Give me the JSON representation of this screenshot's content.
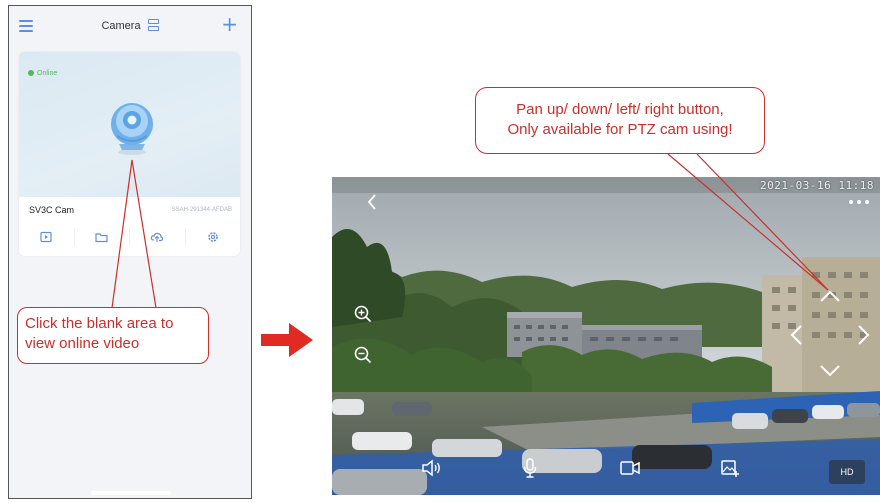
{
  "phone": {
    "header": {
      "title": "Camera"
    },
    "device": {
      "status": "Online",
      "name": "SV3C Cam",
      "id": "SSAH-291344-AFDAB"
    }
  },
  "callouts": {
    "left_line1": "Click the blank area to",
    "left_line2": "view online video",
    "right_line1": "Pan up/ down/ left/ right button,",
    "right_line2": "Only available for PTZ cam using!"
  },
  "video": {
    "timestamp": "2021-03-16 11:18",
    "quality_label": "HD"
  },
  "icons": {
    "menu": "hamburger-icon",
    "view_toggle": "grid-view-icon",
    "add": "plus-icon",
    "camera": "ptz-camera-icon",
    "playback": "playback-icon",
    "folder": "folder-icon",
    "cloud": "cloud-icon",
    "settings": "gear-icon",
    "back": "chevron-left-icon",
    "more": "more-dots-icon",
    "zoom_in": "zoom-in-icon",
    "zoom_out": "zoom-out-icon",
    "pan_up": "chevron-up-icon",
    "pan_down": "chevron-down-icon",
    "pan_left": "chevron-left-icon",
    "pan_right": "chevron-right-icon",
    "speaker": "speaker-icon",
    "microphone": "microphone-icon",
    "record": "video-record-icon",
    "snapshot": "snapshot-icon"
  },
  "colors": {
    "accent_blue": "#5f8fd8",
    "online_green": "#58b368",
    "annotation_red": "#c9302c",
    "arrow_red": "#e02a24"
  }
}
